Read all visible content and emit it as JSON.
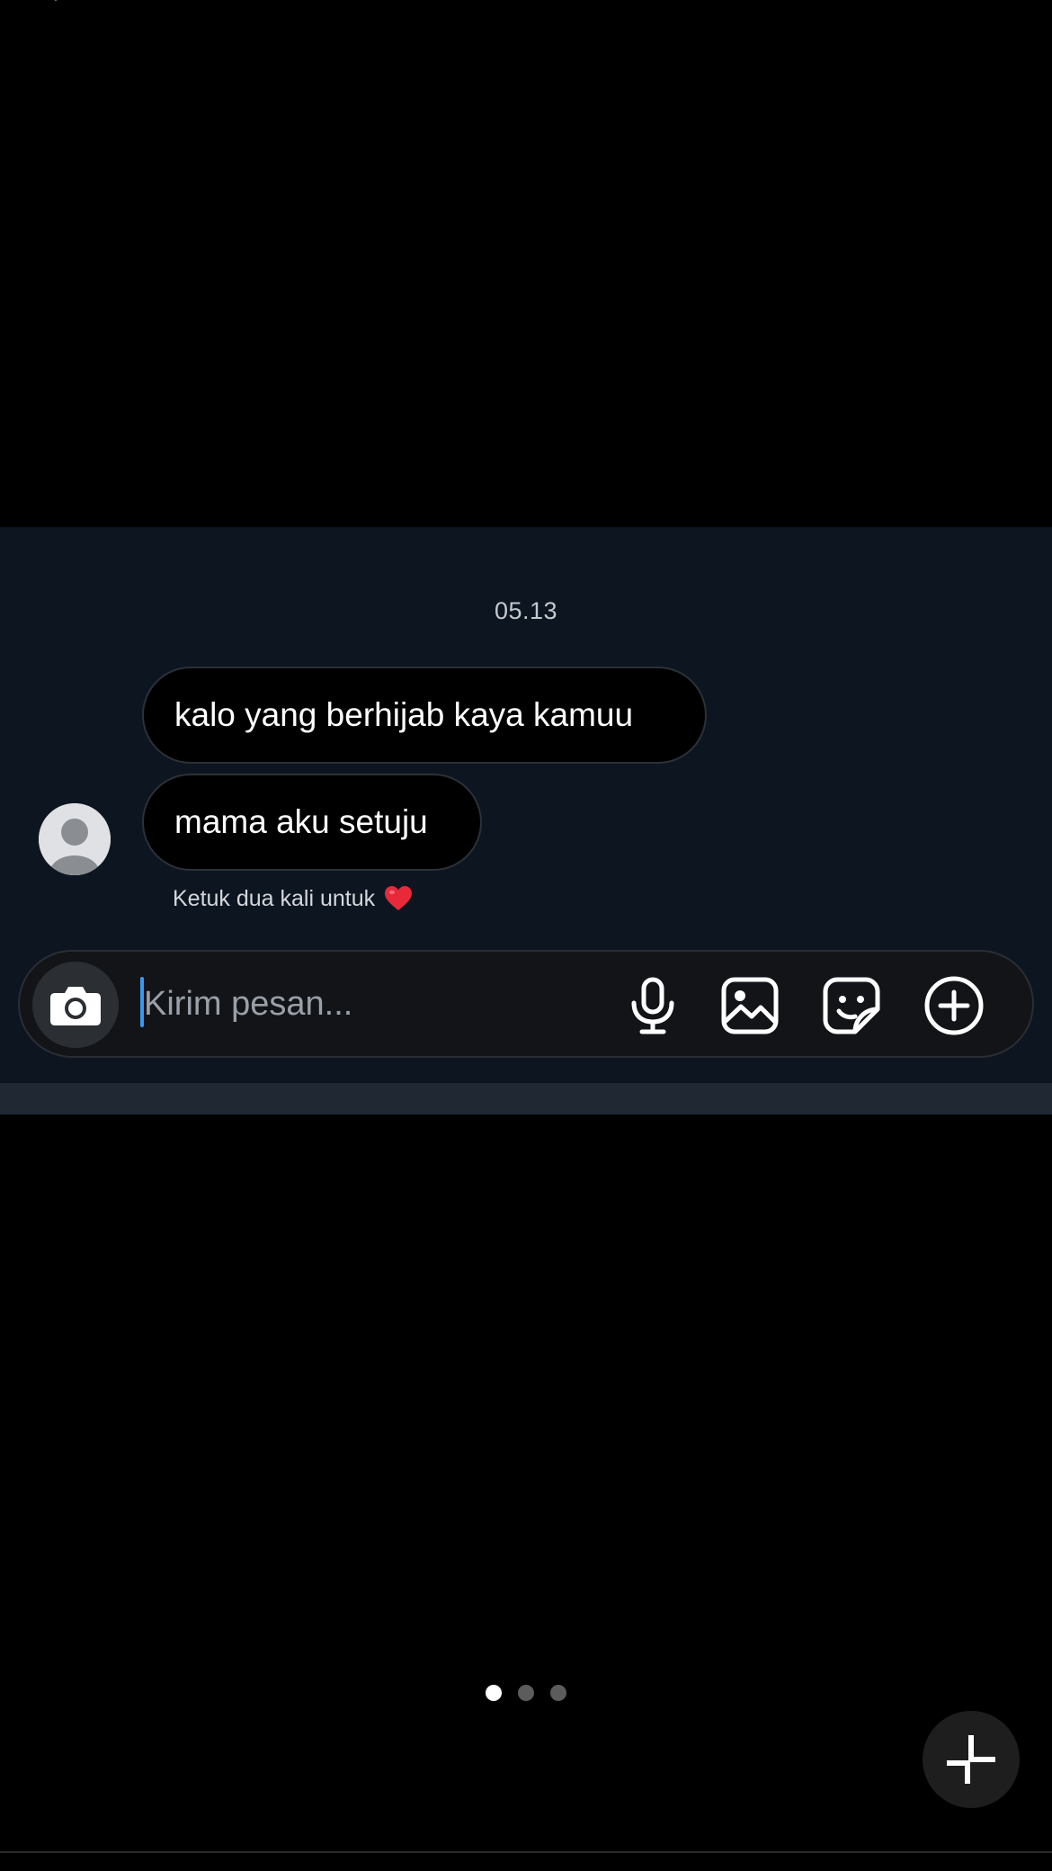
{
  "chat": {
    "timestamp": "05.13",
    "messages": [
      {
        "text": "kalo yang berhijab kaya kamuu"
      },
      {
        "text": "mama aku setuju"
      }
    ],
    "double_tap_hint": "Ketuk dua kali untuk",
    "heart_color": "#e8293a"
  },
  "composer": {
    "placeholder": "Kirim pesan...",
    "value": "",
    "icons": [
      "camera-icon",
      "microphone-icon",
      "gallery-icon",
      "sticker-icon",
      "plus-circle-icon"
    ],
    "caret_color": "#3897f0"
  },
  "viewer": {
    "pages": 3,
    "active_page": 1,
    "icons": [
      "back-chevron-icon",
      "minimize-icon"
    ]
  },
  "colors": {
    "page_background": "#000000",
    "chat_background": "#0d1520",
    "bubble_background": "#000000"
  }
}
